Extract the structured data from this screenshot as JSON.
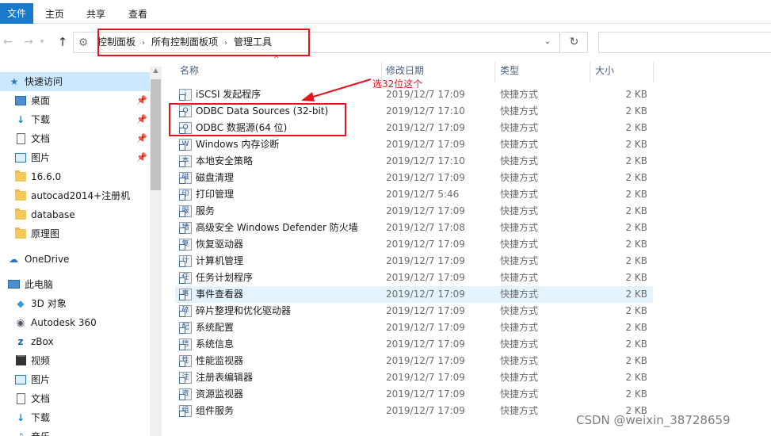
{
  "ribbon": {
    "tabs": [
      "文件",
      "主页",
      "共享",
      "查看"
    ]
  },
  "address": {
    "crumbs": [
      "控制面板",
      "所有控制面板项",
      "管理工具"
    ]
  },
  "sidebar": {
    "quick_access": "快速访问",
    "items": [
      {
        "label": "桌面",
        "pinned": true
      },
      {
        "label": "下载",
        "pinned": true
      },
      {
        "label": "文档",
        "pinned": true
      },
      {
        "label": "图片",
        "pinned": true
      },
      {
        "label": "16.6.0"
      },
      {
        "label": "autocad2014+注册机"
      },
      {
        "label": "database"
      },
      {
        "label": "原理图"
      }
    ],
    "onedrive": "OneDrive",
    "this_pc": "此电脑",
    "pc_items": [
      "3D 对象",
      "Autodesk 360",
      "zBox",
      "视频",
      "图片",
      "文档",
      "下载",
      "音乐"
    ]
  },
  "columns": {
    "name": "名称",
    "date": "修改日期",
    "type": "类型",
    "size": "大小"
  },
  "files": [
    {
      "name": "iSCSI 发起程序",
      "date": "2019/12/7 17:09",
      "type": "快捷方式",
      "size": "2 KB"
    },
    {
      "name": "ODBC Data Sources (32-bit)",
      "date": "2019/12/7 17:10",
      "type": "快捷方式",
      "size": "2 KB"
    },
    {
      "name": "ODBC 数据源(64 位)",
      "date": "2019/12/7 17:09",
      "type": "快捷方式",
      "size": "2 KB"
    },
    {
      "name": "Windows 内存诊断",
      "date": "2019/12/7 17:09",
      "type": "快捷方式",
      "size": "2 KB"
    },
    {
      "name": "本地安全策略",
      "date": "2019/12/7 17:10",
      "type": "快捷方式",
      "size": "2 KB"
    },
    {
      "name": "磁盘清理",
      "date": "2019/12/7 17:09",
      "type": "快捷方式",
      "size": "2 KB"
    },
    {
      "name": "打印管理",
      "date": "2019/12/7 5:46",
      "type": "快捷方式",
      "size": "2 KB"
    },
    {
      "name": "服务",
      "date": "2019/12/7 17:09",
      "type": "快捷方式",
      "size": "2 KB"
    },
    {
      "name": "高级安全 Windows Defender 防火墙",
      "date": "2019/12/7 17:08",
      "type": "快捷方式",
      "size": "2 KB"
    },
    {
      "name": "恢复驱动器",
      "date": "2019/12/7 17:09",
      "type": "快捷方式",
      "size": "2 KB"
    },
    {
      "name": "计算机管理",
      "date": "2019/12/7 17:09",
      "type": "快捷方式",
      "size": "2 KB"
    },
    {
      "name": "任务计划程序",
      "date": "2019/12/7 17:09",
      "type": "快捷方式",
      "size": "2 KB"
    },
    {
      "name": "事件查看器",
      "date": "2019/12/7 17:09",
      "type": "快捷方式",
      "size": "2 KB"
    },
    {
      "name": "碎片整理和优化驱动器",
      "date": "2019/12/7 17:09",
      "type": "快捷方式",
      "size": "2 KB"
    },
    {
      "name": "系统配置",
      "date": "2019/12/7 17:09",
      "type": "快捷方式",
      "size": "2 KB"
    },
    {
      "name": "系统信息",
      "date": "2019/12/7 17:09",
      "type": "快捷方式",
      "size": "2 KB"
    },
    {
      "name": "性能监视器",
      "date": "2019/12/7 17:09",
      "type": "快捷方式",
      "size": "2 KB"
    },
    {
      "name": "注册表编辑器",
      "date": "2019/12/7 17:09",
      "type": "快捷方式",
      "size": "2 KB"
    },
    {
      "name": "资源监视器",
      "date": "2019/12/7 17:09",
      "type": "快捷方式",
      "size": "2 KB"
    },
    {
      "name": "组件服务",
      "date": "2019/12/7 17:09",
      "type": "快捷方式",
      "size": "2 KB"
    }
  ],
  "annotation": {
    "text": "选32位这个",
    "color": "#e8141c"
  },
  "watermark": "CSDN @weixin_38728659"
}
